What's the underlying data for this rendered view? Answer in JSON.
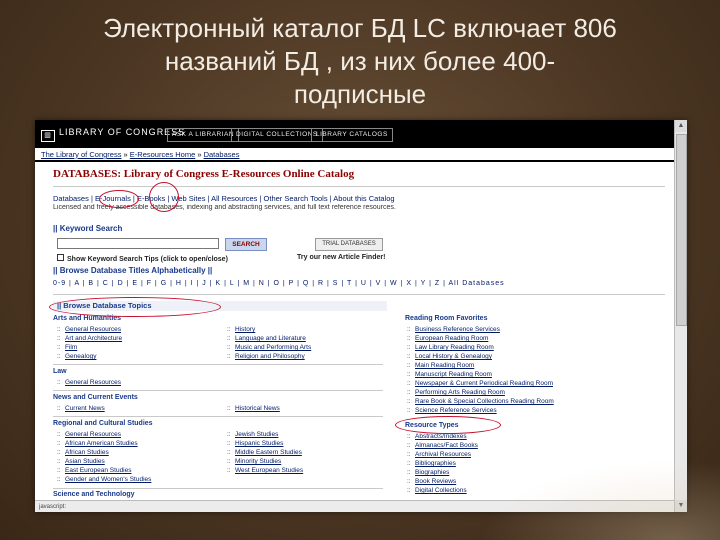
{
  "slide": {
    "title_lines": [
      "Электронный каталог БД LC включает 806",
      "названий БД , из них более 400-",
      "подписные"
    ]
  },
  "site": {
    "logo": "LIBRARY OF CONGRESS",
    "top_buttons": [
      "ASK A LIBRARIAN",
      "DIGITAL COLLECTIONS",
      "LIBRARY CATALOGS"
    ],
    "breadcrumb": [
      "The Library of Congress",
      "E-Resources Home",
      "Databases"
    ],
    "title_main": "DATABASES: Library of Congress E-Resources Online Catalog",
    "nav": "Databases | E-Journals | E-Books | Web Sites | All Resources | Other Search Tools | About this Catalog",
    "description": "Licensed and freely accessible databases, indexing and abstracting services, and full text reference resources.",
    "keyword_search": "|| Keyword Search",
    "search_button": "SEARCH",
    "trial_button": "TRIAL DATABASES",
    "tips": "Show Keyword Search Tips (click to open/close)",
    "new_article": "Try our new Article Finder!",
    "browse_alpha": "|| Browse Database Titles Alphabetically ||",
    "letters": "0-9 | A | B | C | D | E | F | G | H | I | J | K | L | M | N | O | P | Q | R | S | T | U | V | W | X | Y | Z | All Databases",
    "browse_topics": "|| Browse Database Topics",
    "categories": {
      "arts": "Arts and Humanities",
      "arts_left": [
        "General Resources",
        "Art and Architecture",
        "Film",
        "Genealogy"
      ],
      "arts_right": [
        "History",
        "Language and Literature",
        "Music and Performing Arts",
        "Religion and Philosophy"
      ],
      "law": "Law",
      "law_items": [
        "General Resources"
      ],
      "news": "News and Current Events",
      "news_left": [
        "Current News"
      ],
      "news_right": [
        "Historical News"
      ],
      "regional": "Regional and Cultural Studies",
      "regional_left": [
        "General Resources",
        "African American Studies",
        "African Studies",
        "Asian Studies",
        "East European Studies",
        "Gender and Women's Studies"
      ],
      "regional_right": [
        "Jewish Studies",
        "Hispanic Studies",
        "Middle Eastern Studies",
        "Minority Studies",
        "West European Studies"
      ],
      "science": "Science and Technology"
    },
    "reading_room": {
      "title": "Reading Room Favorites",
      "items": [
        "Business Reference Services",
        "European Reading Room",
        "Law Library Reading Room",
        "Local History & Genealogy",
        "Main Reading Room",
        "Manuscript Reading Room",
        "Newspaper & Current Periodical Reading Room",
        "Performing Arts Reading Room",
        "Rare Book & Special Collections Reading Room",
        "Science Reference Services"
      ]
    },
    "resource_types": {
      "title": "Resource Types",
      "items": [
        "Abstracts/Indexes",
        "Almanacs/Fact Books",
        "Archival Resources",
        "Bibliographies",
        "Biographies",
        "Book Reviews",
        "Digital Collections"
      ]
    },
    "status_text": "javascript:"
  },
  "colors": {
    "background": "#4a3522",
    "title_text": "#f2ece2",
    "link": "#001a66",
    "db_title": "#8b0000",
    "annotation": "#c8102e"
  }
}
